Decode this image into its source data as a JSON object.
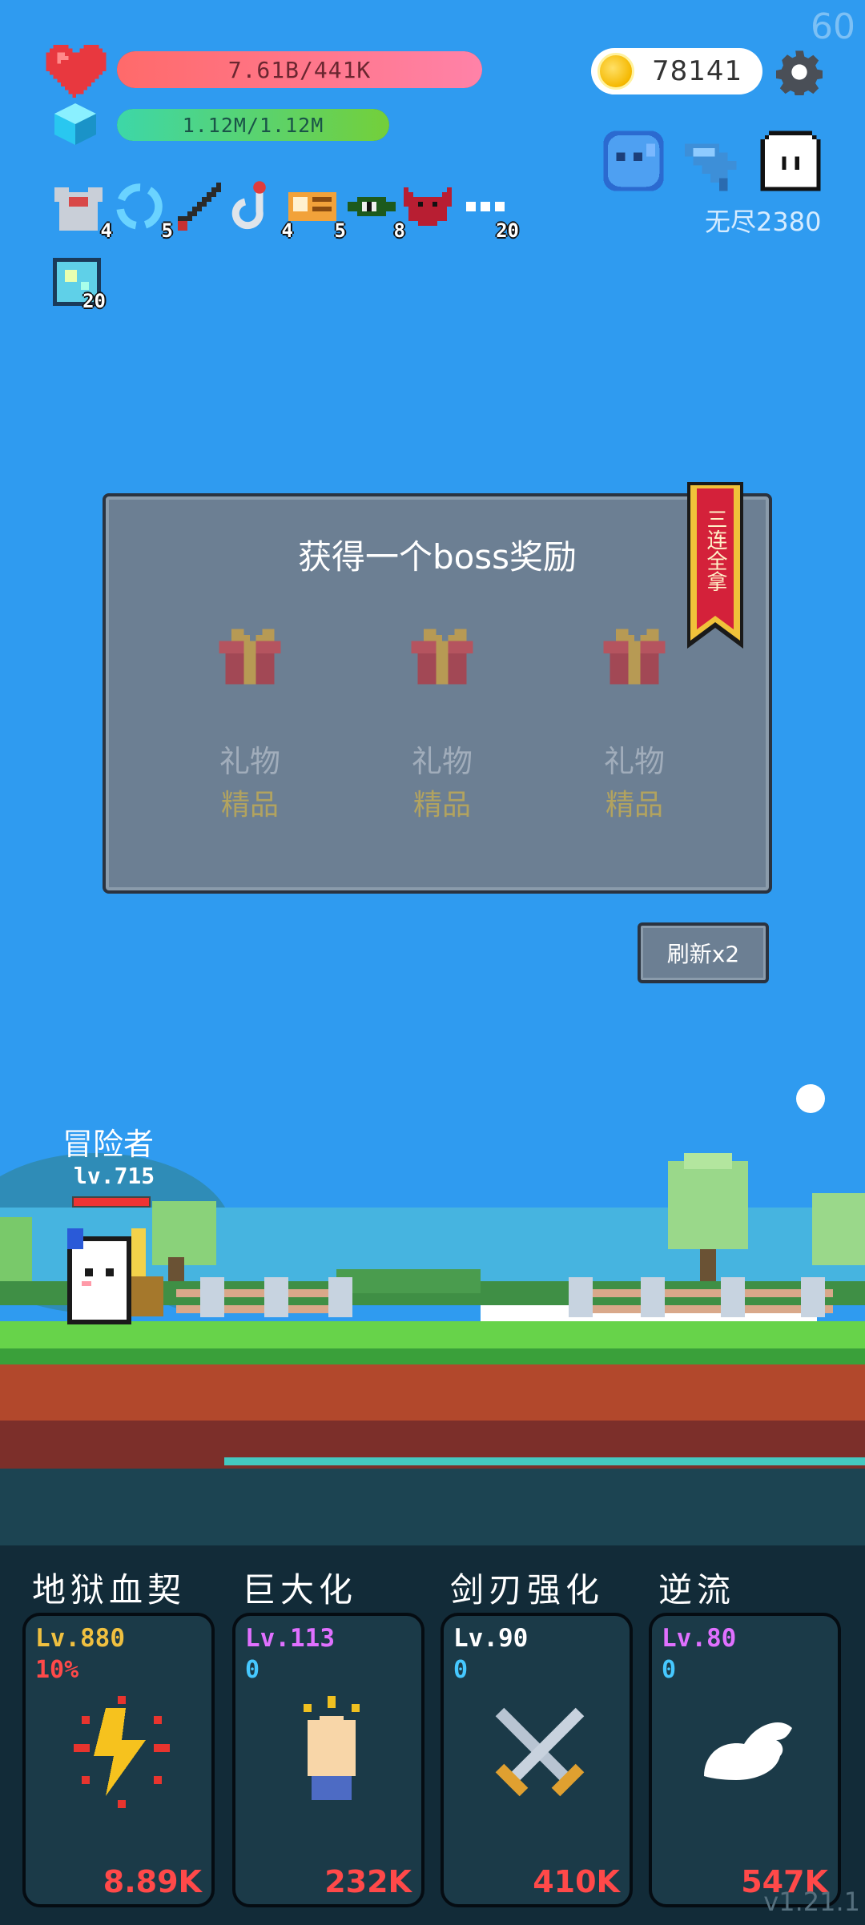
{
  "fps": "60",
  "hud": {
    "hp_text": "7.61B/441K",
    "hp_fraction": 1.0,
    "mp_text": "1.12M/1.12M",
    "mp_fraction": 1.0,
    "coins": "78141",
    "endless_label": "无尽2380"
  },
  "buffs": [
    {
      "icon": "armor-icon",
      "count": "4"
    },
    {
      "icon": "cycle-icon",
      "count": "5"
    },
    {
      "icon": "sword-icon",
      "count": ""
    },
    {
      "icon": "hook-icon",
      "count": "4"
    },
    {
      "icon": "scroll-icon",
      "count": "5"
    },
    {
      "icon": "eye-icon",
      "count": "8"
    },
    {
      "icon": "demon-icon",
      "count": ""
    },
    {
      "icon": "more-icon",
      "count": "20"
    }
  ],
  "buff_row2": {
    "icon": "crystal-icon",
    "count": "20"
  },
  "reward": {
    "title": "获得一个boss奖励",
    "ribbon": "三连全拿",
    "gifts": [
      {
        "name": "礼物",
        "quality": "精品"
      },
      {
        "name": "礼物",
        "quality": "精品"
      },
      {
        "name": "礼物",
        "quality": "精品"
      }
    ],
    "refresh_label": "刷新x2"
  },
  "hero": {
    "name": "冒险者",
    "level": "lv.715",
    "hp_fraction": 1.0
  },
  "skills": [
    {
      "title": "地狱血契",
      "level": "Lv.880",
      "sub": "10%",
      "cost": "8.89K",
      "level_color": "#f0c040",
      "sub_color": "#ff4949",
      "icon": "lightning-icon"
    },
    {
      "title": "巨大化",
      "level": "Lv.113",
      "sub": "0",
      "cost": "232K",
      "level_color": "#e070ff",
      "sub_color": "#46c8ff",
      "icon": "fist-icon"
    },
    {
      "title": "剑刃强化",
      "level": "Lv.90",
      "sub": "0",
      "cost": "410K",
      "level_color": "#ffffff",
      "sub_color": "#46c8ff",
      "icon": "crossed-swords-icon"
    },
    {
      "title": "逆流",
      "level": "Lv.80",
      "sub": "0",
      "cost": "547K",
      "level_color": "#e070ff",
      "sub_color": "#46c8ff",
      "icon": "wing-icon"
    }
  ],
  "version": "v1.21.1"
}
